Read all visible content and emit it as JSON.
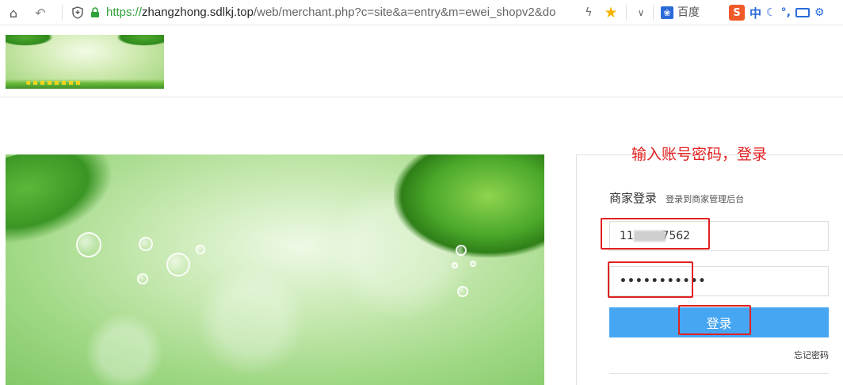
{
  "browser": {
    "url_scheme": "https://",
    "url_host": "zhangzhong.sdlkj.top",
    "url_path": "/web/merchant.php?c=site&a=entry&m=ewei_shopv2&do",
    "search_engine_label": "百度",
    "ime_label": "中",
    "icons": [
      "home-icon",
      "back-icon",
      "shield-icon",
      "lock-icon",
      "bolt-icon",
      "star-icon",
      "chevron-down-icon",
      "baidu-icon",
      "ime-logo-icon",
      "moon-icon",
      "punctuation-icon",
      "keyboard-icon",
      "skin-icon"
    ]
  },
  "annotation": "输入账号密码，登录",
  "login": {
    "title": "商家登录",
    "subtitle": "登录到商家管理后台",
    "username_value": "11        7562",
    "password_value": "•••••••••••",
    "submit_label": "登录",
    "forgot_label": "忘记密码"
  },
  "colors": {
    "accent_button": "#46a6f2",
    "annotation_red": "#e02020",
    "url_green": "#2fa23a"
  }
}
